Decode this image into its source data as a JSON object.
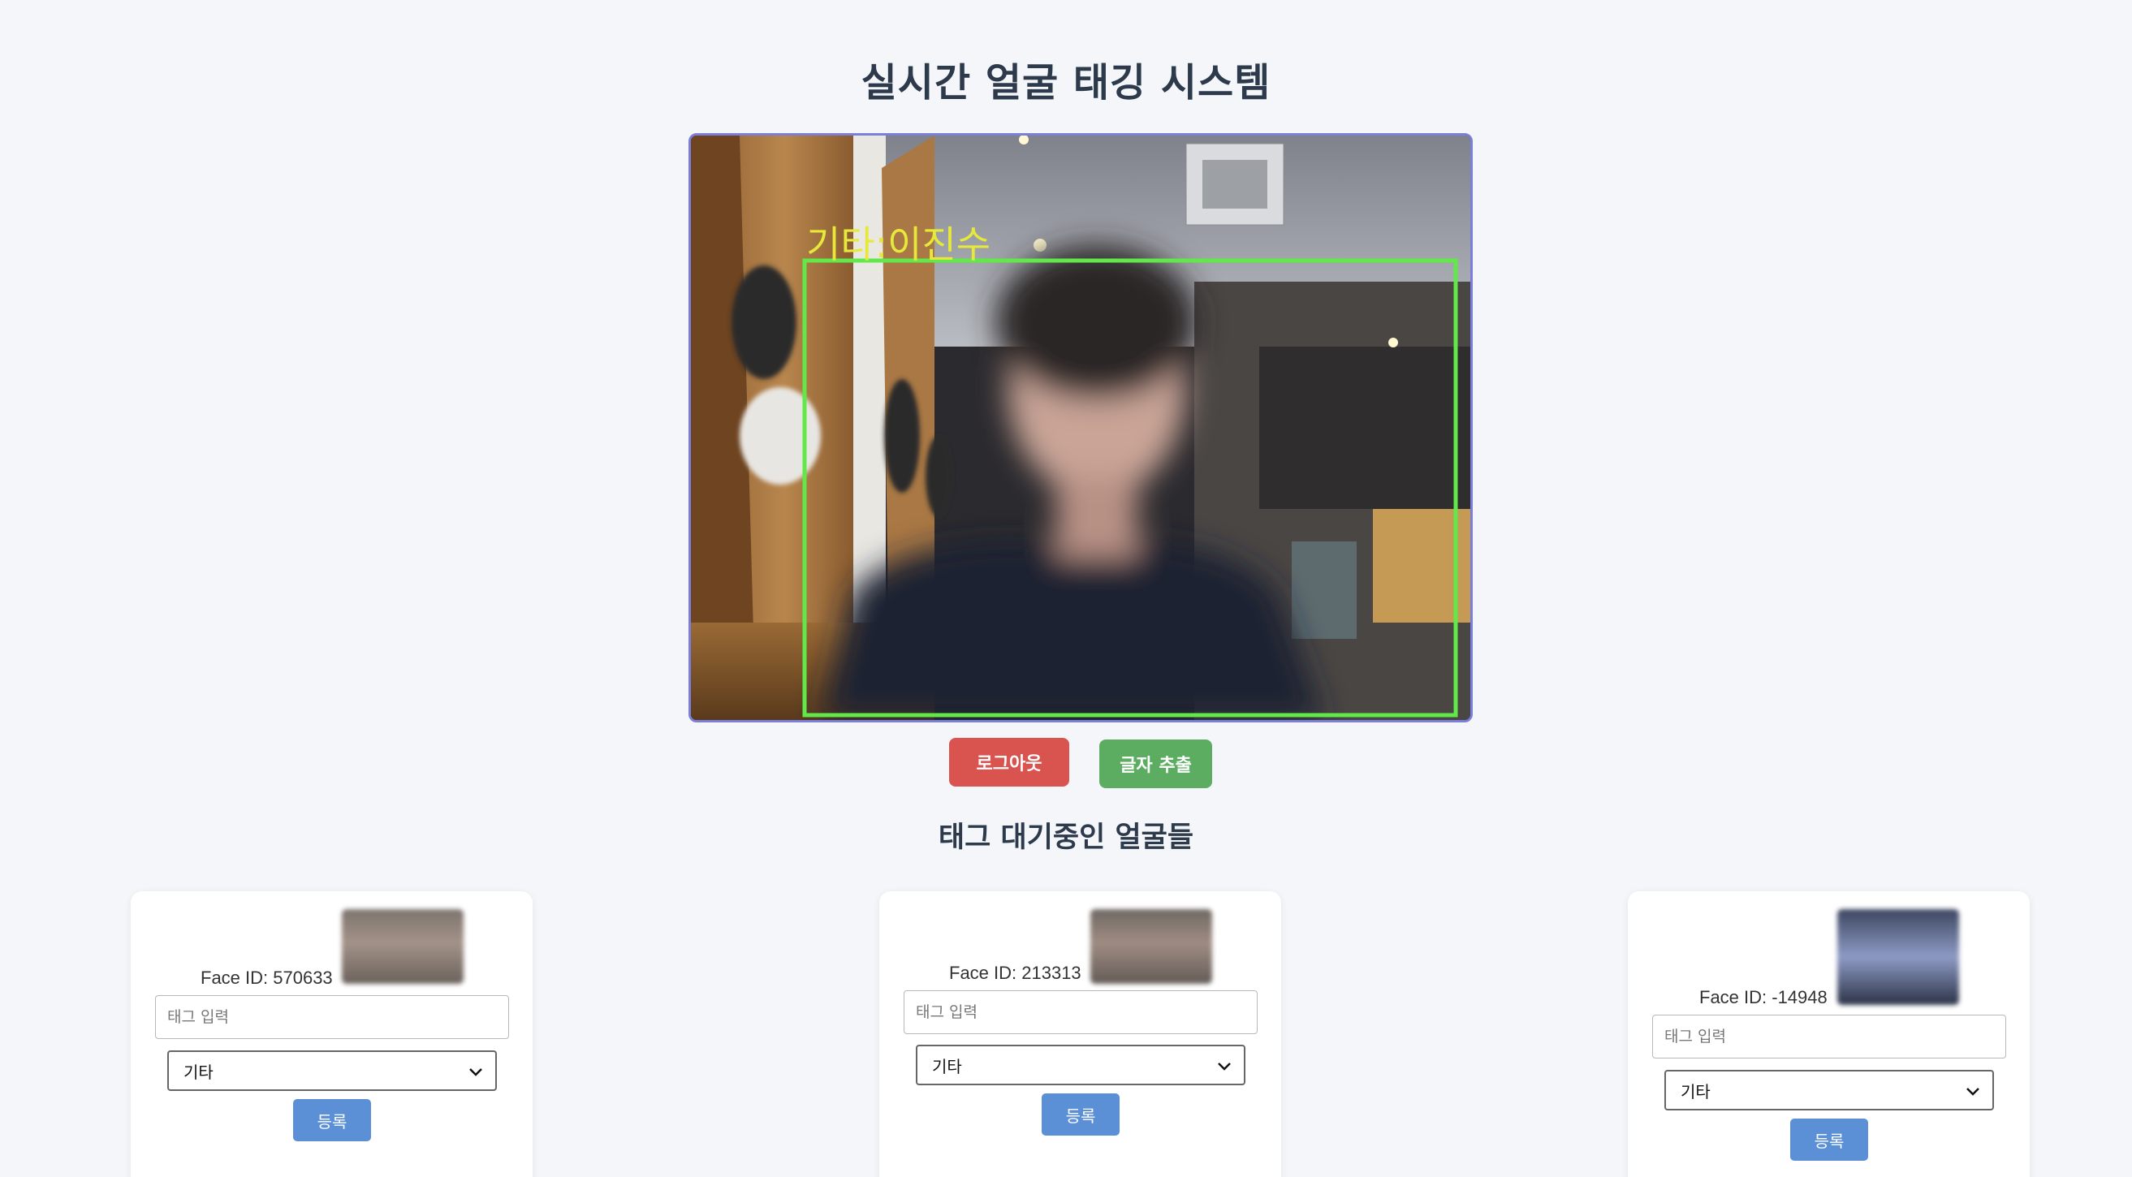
{
  "header": {
    "title": "실시간 얼굴 태깅 시스템"
  },
  "video": {
    "overlay_label": "기타:이진수",
    "box_color": "#63e84a",
    "label_color": "#e6e83a"
  },
  "buttons": {
    "logout": "로그아웃",
    "extract": "글자 추출"
  },
  "section": {
    "title": "태그 대기중인 얼굴들"
  },
  "cards": [
    {
      "face_id": "Face ID: 570633",
      "tag_placeholder": "태그 입력",
      "category": "기타",
      "register": "등록"
    },
    {
      "face_id": "Face ID: 213313",
      "tag_placeholder": "태그 입력",
      "category": "기타",
      "register": "등록"
    },
    {
      "face_id": "Face ID: -14948",
      "tag_placeholder": "태그 입력",
      "category": "기타",
      "register": "등록"
    }
  ],
  "colors": {
    "logout": "#d9534f",
    "extract": "#5cad62",
    "register": "#5c90d6",
    "frame_border": "#7b7fd8"
  }
}
